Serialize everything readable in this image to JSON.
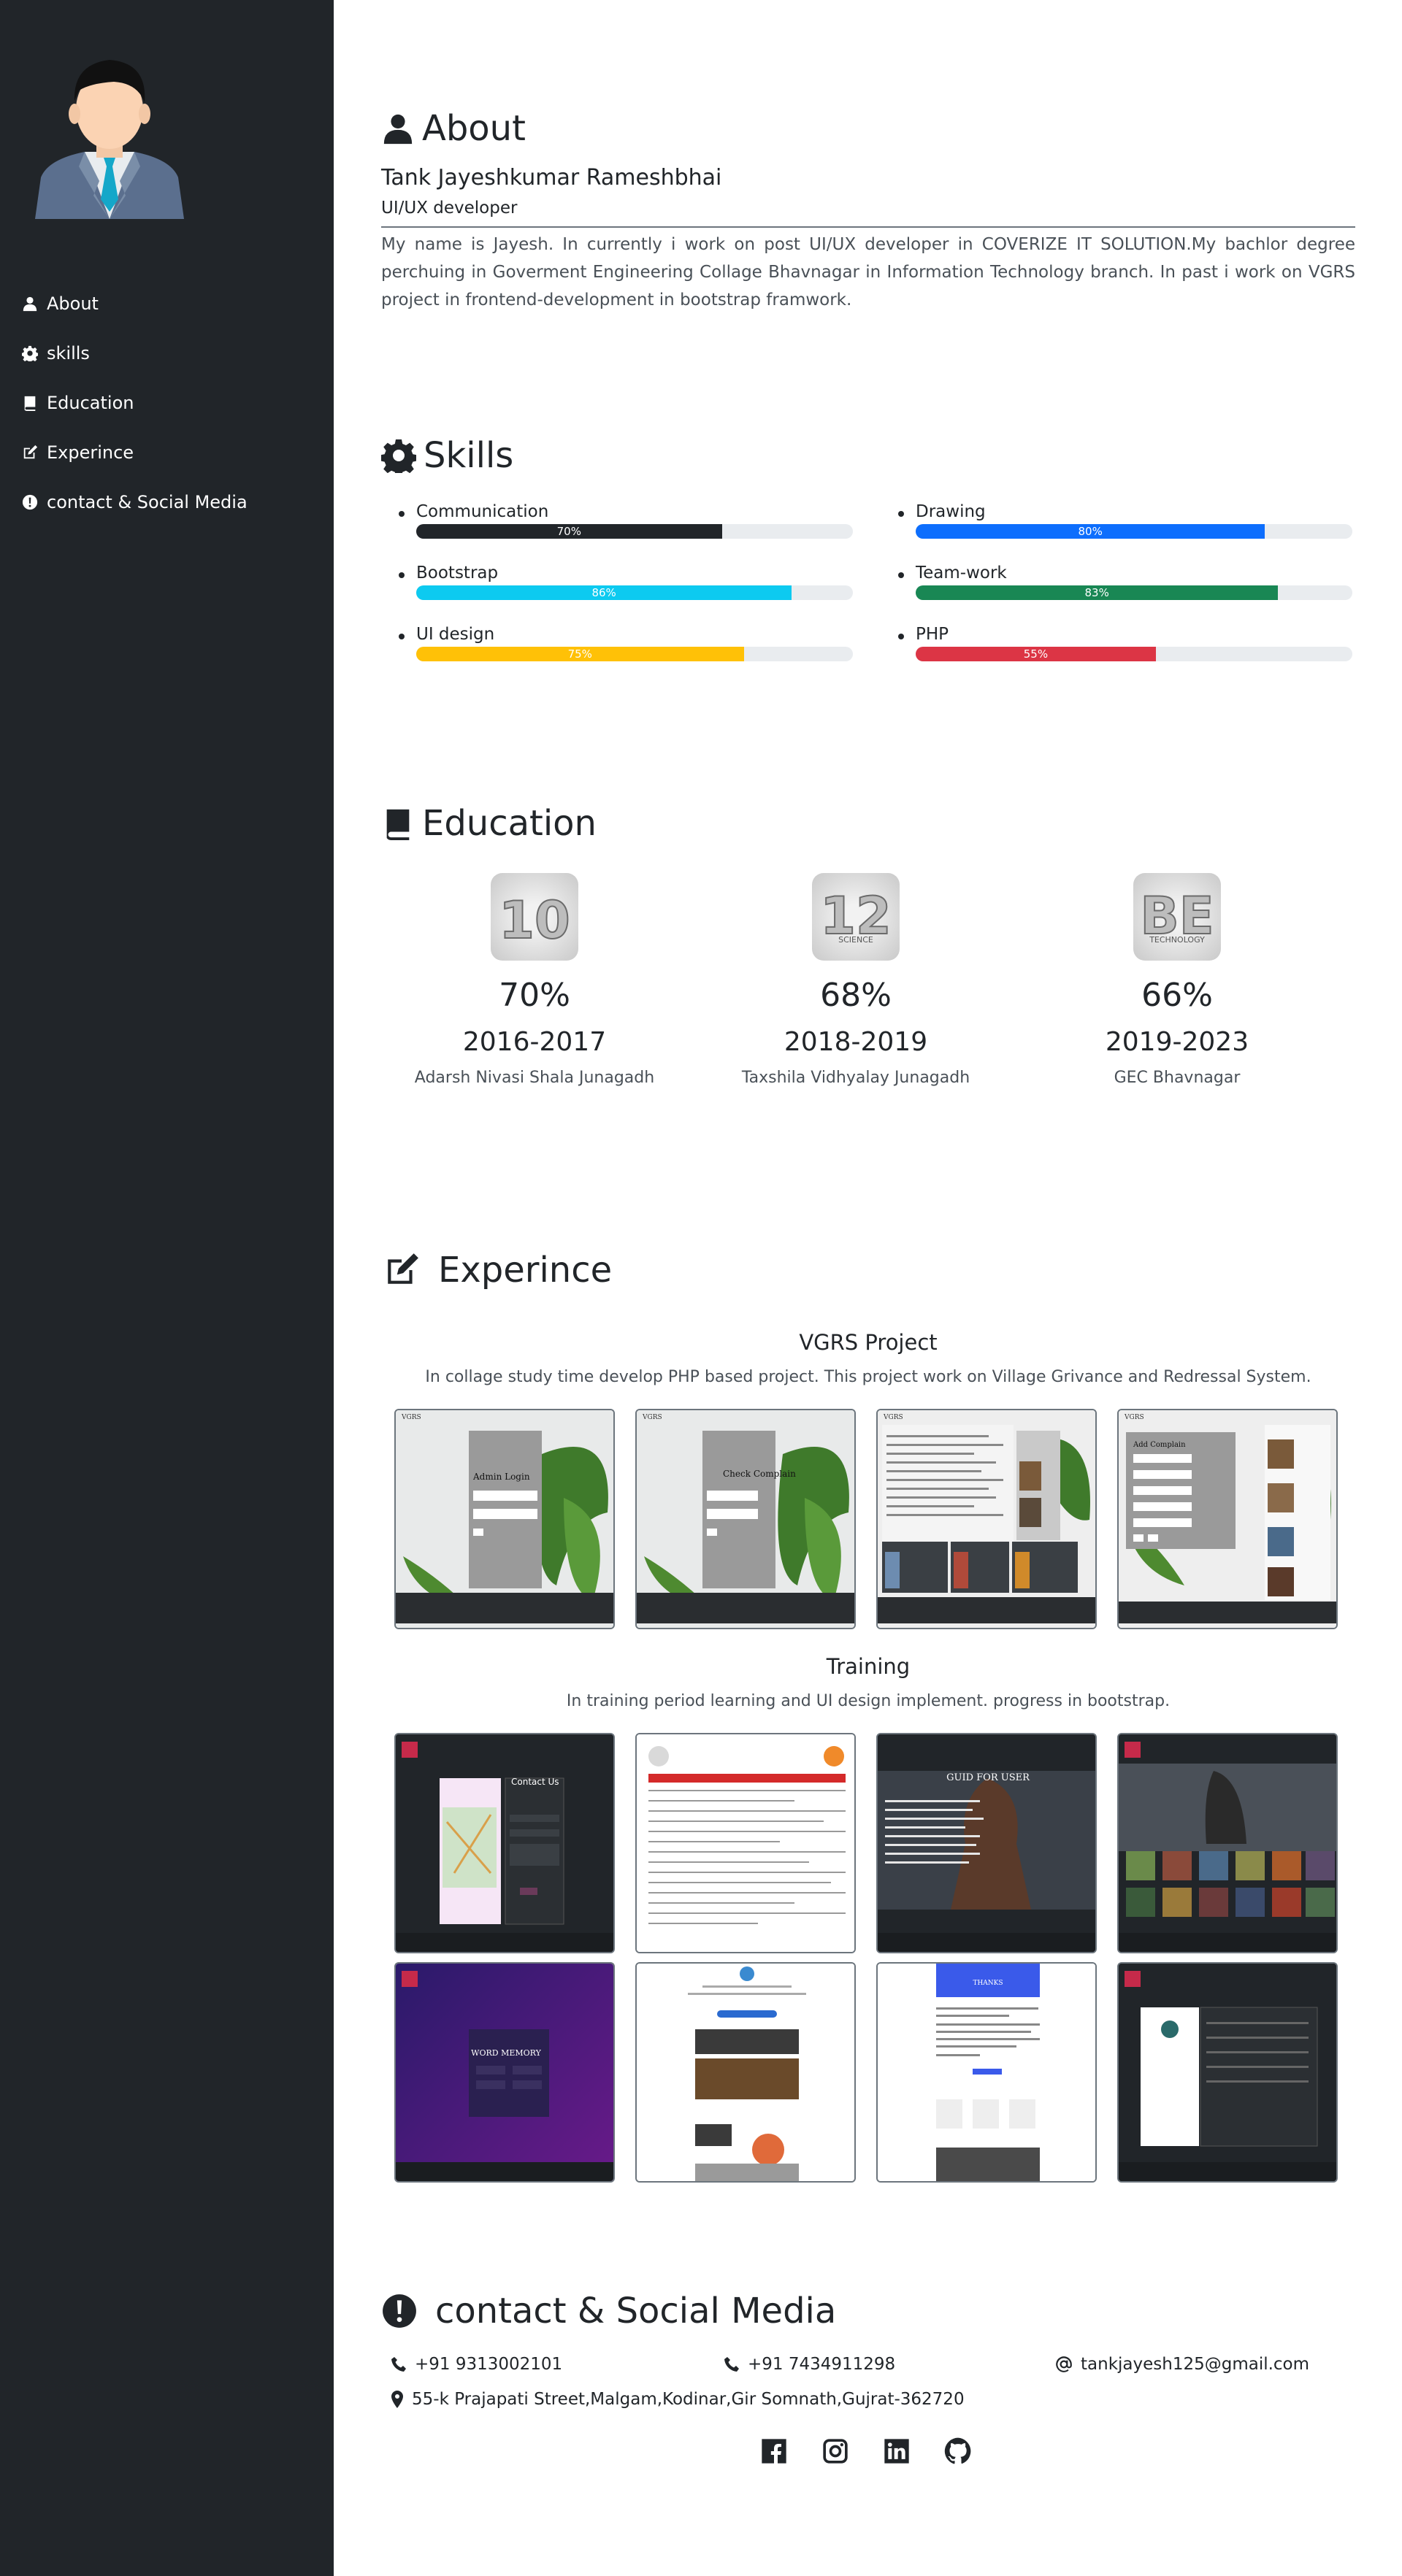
{
  "sidebar": {
    "items": [
      {
        "label": "About",
        "icon": "user-icon"
      },
      {
        "label": "skills",
        "icon": "gear-icon"
      },
      {
        "label": "Education",
        "icon": "book-icon"
      },
      {
        "label": "Experince",
        "icon": "edit-icon"
      },
      {
        "label": "contact & Social Media",
        "icon": "exclamation-circle-icon"
      }
    ]
  },
  "about": {
    "title": "About",
    "name": "Tank Jayeshkumar Rameshbhai",
    "role": "UI/UX developer",
    "bio": "My name is Jayesh. In currently i work on post UI/UX developer in COVERIZE IT SOLUTION.My bachlor degree perchuing in Goverment Engineering Collage Bhavnagar in Information Technology branch. In past i work on VGRS project in frontend-development in bootstrap framwork."
  },
  "skills": {
    "title": "Skills",
    "items": [
      {
        "name": "Communication",
        "percent": 70,
        "label": "70%",
        "color": "#212529"
      },
      {
        "name": "Drawing",
        "percent": 80,
        "label": "80%",
        "color": "#0d6efd"
      },
      {
        "name": "Bootstrap",
        "percent": 86,
        "label": "86%",
        "color": "#0dcaf0"
      },
      {
        "name": "Team-work",
        "percent": 83,
        "label": "83%",
        "color": "#198754"
      },
      {
        "name": "UI design",
        "percent": 75,
        "label": "75%",
        "color": "#ffc107"
      },
      {
        "name": "PHP",
        "percent": 55,
        "label": "55%",
        "color": "#dc3545"
      }
    ]
  },
  "education": {
    "title": "Education",
    "items": [
      {
        "badge": "10",
        "badge_sub": "",
        "percent": "70%",
        "years": "2016-2017",
        "school": "Adarsh Nivasi Shala Junagadh"
      },
      {
        "badge": "12",
        "badge_sub": "SCIENCE",
        "percent": "68%",
        "years": "2018-2019",
        "school": "Taxshila Vidhyalay Junagadh"
      },
      {
        "badge": "BE",
        "badge_sub": "TECHNOLOGY",
        "percent": "66%",
        "years": "2019-2023",
        "school": "GEC Bhavnagar"
      }
    ]
  },
  "experience": {
    "title": "Experince",
    "projects": [
      {
        "title": "VGRS Project",
        "desc": "In collage study time develop PHP based project. This project work on Village Grivance and Redressal System."
      },
      {
        "title": "Training",
        "desc": "In training period learning and UI design implement. progress in bootstrap."
      }
    ],
    "vgrs_thumbs": [
      {
        "form_title": "Admin Login"
      },
      {
        "form_title": "Check Complain"
      },
      {
        "form_title": ""
      },
      {
        "form_title": "Add Complain"
      }
    ],
    "training_thumbs": [
      {
        "caption": "Contact Us"
      },
      {
        "caption": ""
      },
      {
        "caption": "GUID FOR USER"
      },
      {
        "caption": ""
      },
      {
        "caption": "WORD MEMORY"
      },
      {
        "caption": ""
      },
      {
        "caption": "THANKS"
      },
      {
        "caption": ""
      }
    ]
  },
  "contact": {
    "title": "contact & Social Media",
    "phone1": "+91 9313002101",
    "phone2": "+91 7434911298",
    "email": "tankjayesh125@gmail.com",
    "address": "55-k Prajapati Street,Malgam,Kodinar,Gir Somnath,Gujrat-362720",
    "social": [
      "facebook-icon",
      "instagram-icon",
      "linkedin-icon",
      "github-icon"
    ]
  }
}
